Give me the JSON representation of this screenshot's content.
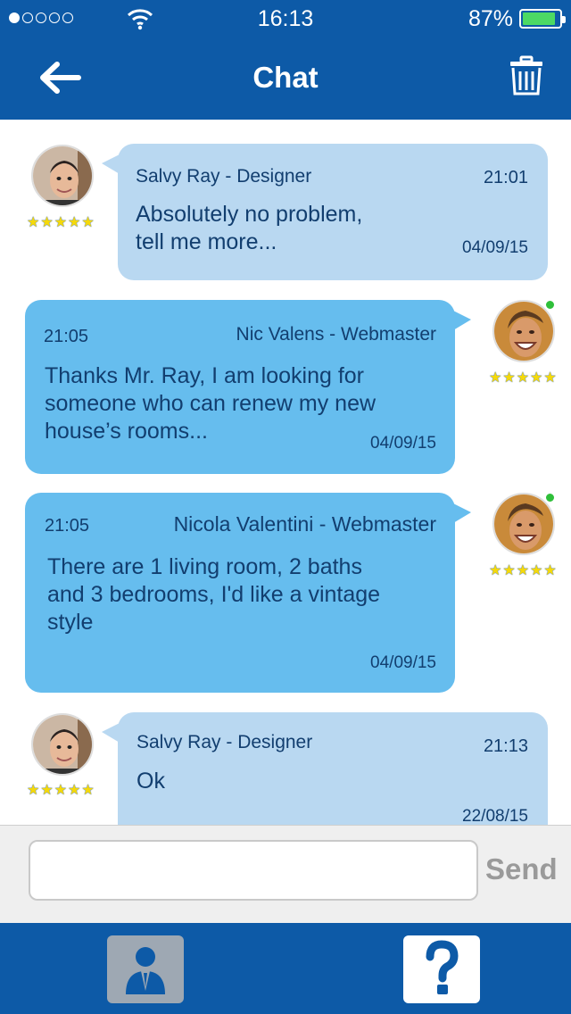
{
  "status_bar": {
    "time": "16:13",
    "battery": "87%"
  },
  "header": {
    "title": "Chat",
    "back_icon": "arrow-left-icon",
    "delete_icon": "trash-icon"
  },
  "messages": [
    {
      "direction": "incoming",
      "sender": "Salvy Ray - Designer",
      "time": "21:01",
      "text_lines": [
        "Absolutely no problem,",
        "tell me more..."
      ],
      "date": "04/09/15",
      "rating": 5
    },
    {
      "direction": "outgoing",
      "sender": "Nic Valens - Webmaster",
      "time": "21:05",
      "text_lines": [
        "Thanks Mr. Ray, I am looking for",
        "someone who can renew my new",
        "house’s rooms..."
      ],
      "date": "04/09/15",
      "rating": 5,
      "online": true
    },
    {
      "direction": "outgoing",
      "sender": "Nicola Valentini - Webmaster",
      "time": "21:05",
      "text_lines": [
        "There are 1 living room, 2 baths",
        "and 3 bedrooms, I'd like a vintage",
        "style"
      ],
      "date": "04/09/15",
      "rating": 5,
      "online": true
    },
    {
      "direction": "incoming",
      "sender": "Salvy Ray - Designer",
      "time": "21:13",
      "text_lines": [
        "Ok"
      ],
      "date": "22/08/15",
      "rating": 5
    }
  ],
  "composer": {
    "input_value": "",
    "placeholder": "",
    "send_label": "Send"
  },
  "tabbar": {
    "profile_icon": "user-profile-icon",
    "help_icon": "question-mark-icon"
  },
  "colors": {
    "brand_blue": "#0d5aa7",
    "incoming_bubble": "#b9d8f1",
    "outgoing_bubble": "#66bdee",
    "online": "#2fbf3a",
    "star": "#f5d90a"
  }
}
